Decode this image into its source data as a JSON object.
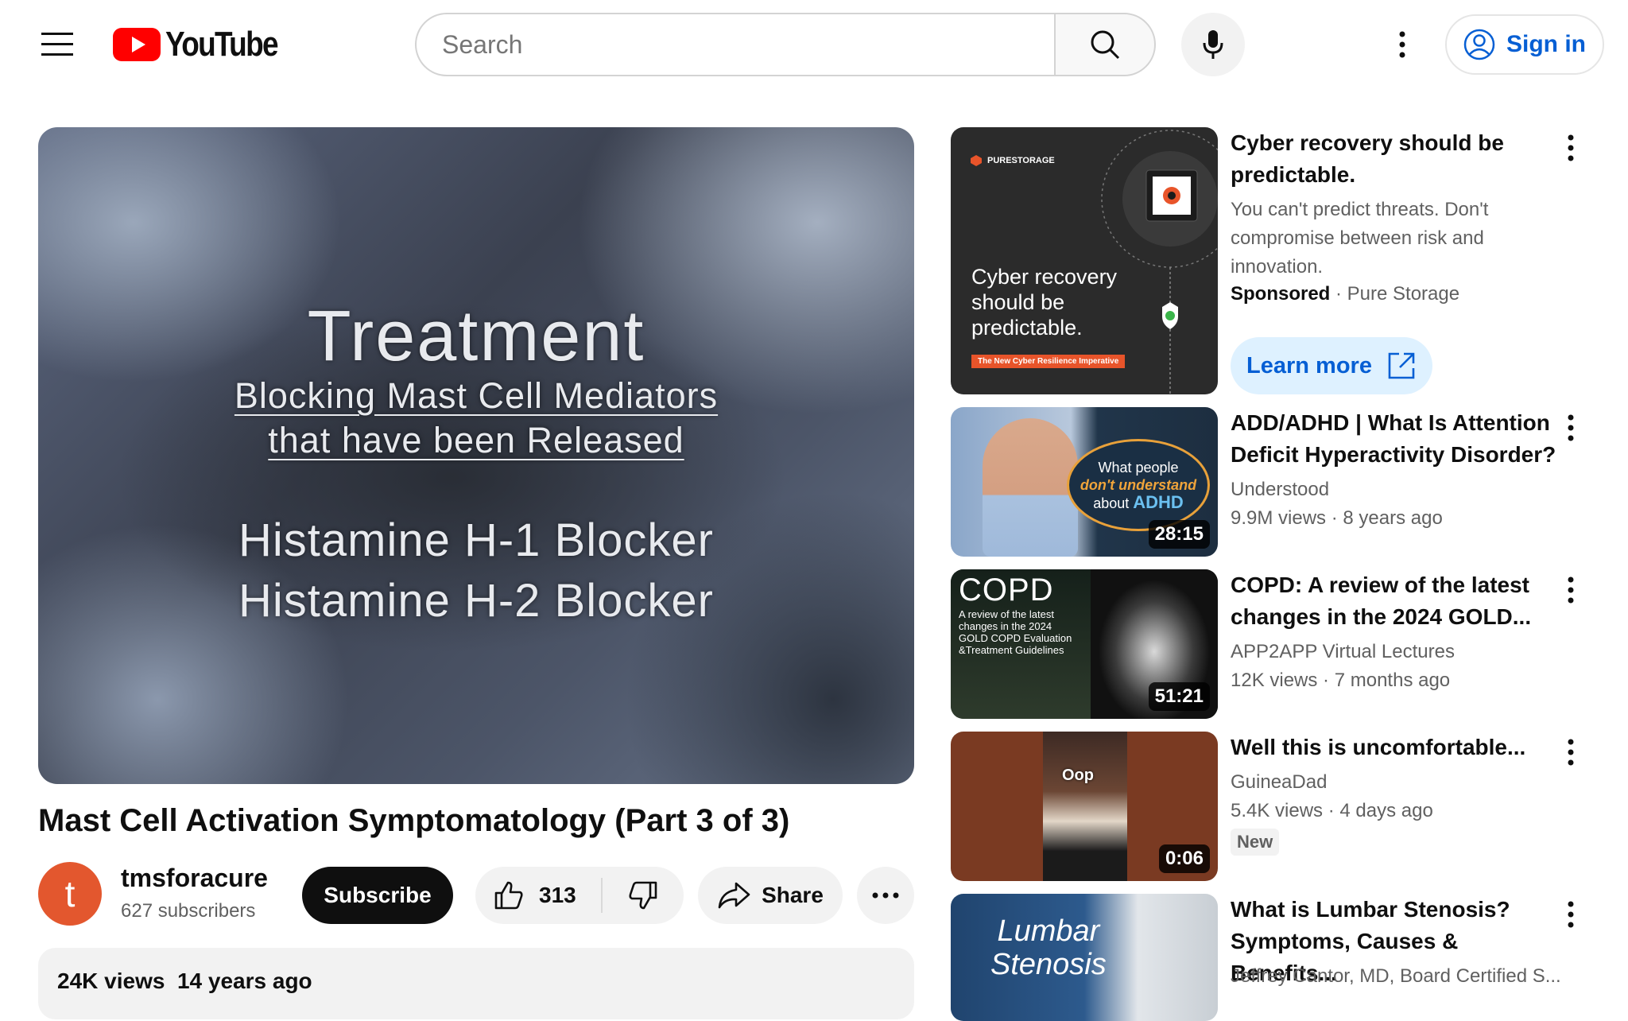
{
  "header": {
    "logo_text": "YouTube",
    "search_placeholder": "Search",
    "sign_in_label": "Sign in"
  },
  "player": {
    "slide_title": "Treatment",
    "slide_subtitle_line1": "Blocking Mast Cell Mediators",
    "slide_subtitle_line2": "that have been Released",
    "slide_item1": "Histamine H-1 Blocker",
    "slide_item2": "Histamine H-2 Blocker"
  },
  "video": {
    "title": "Mast Cell Activation Symptomatology (Part 3 of 3)",
    "channel_initial": "t",
    "channel_name": "tmsforacure",
    "subscribers": "627 subscribers",
    "subscribe_label": "Subscribe",
    "like_count": "313",
    "share_label": "Share",
    "views": "24K views",
    "age": "14 years ago"
  },
  "sidebar": {
    "ad": {
      "thumb_brand": "PURESTORAGE",
      "thumb_text": "Cyber recovery should be predictable.",
      "thumb_tagline": "The New Cyber Resilience Imperative",
      "title": "Cyber recovery should be predictable.",
      "description": "You can't predict threats. Don't compromise between risk and innovation.",
      "sponsored_label": "Sponsored",
      "advertiser": "Pure Storage",
      "cta_label": "Learn more"
    },
    "videos": [
      {
        "title": "ADD/ADHD | What Is Attention Deficit Hyperactivity Disorder?",
        "channel": "Understood",
        "views": "9.9M views",
        "age": "8 years ago",
        "duration": "28:15",
        "thumb_line1": "What people",
        "thumb_line2": "don't understand",
        "thumb_line3": "about",
        "thumb_line4": "ADHD"
      },
      {
        "title": "COPD: A review of the latest changes in the 2024 GOLD...",
        "channel": "APP2APP Virtual Lectures",
        "views": "12K views",
        "age": "7 months ago",
        "duration": "51:21",
        "thumb_big": "COPD",
        "thumb_small": "A review of the latest changes in the 2024 GOLD COPD Evaluation &Treatment Guidelines"
      },
      {
        "title": "Well this is uncomfortable...",
        "channel": "GuineaDad",
        "views": "5.4K views",
        "age": "4 days ago",
        "badge": "New",
        "duration": "0:06",
        "thumb_caption": "Oop"
      },
      {
        "title": "What is Lumbar Stenosis? Symptoms, Causes & Benefits...",
        "channel": "Jeffrey Cantor, MD, Board Certified S...",
        "thumb_line1": "Lumbar",
        "thumb_line2": "Stenosis"
      }
    ]
  },
  "colors": {
    "brand_red": "#ff0000",
    "link_blue": "#065fd4",
    "avatar_orange": "#e3572e"
  }
}
